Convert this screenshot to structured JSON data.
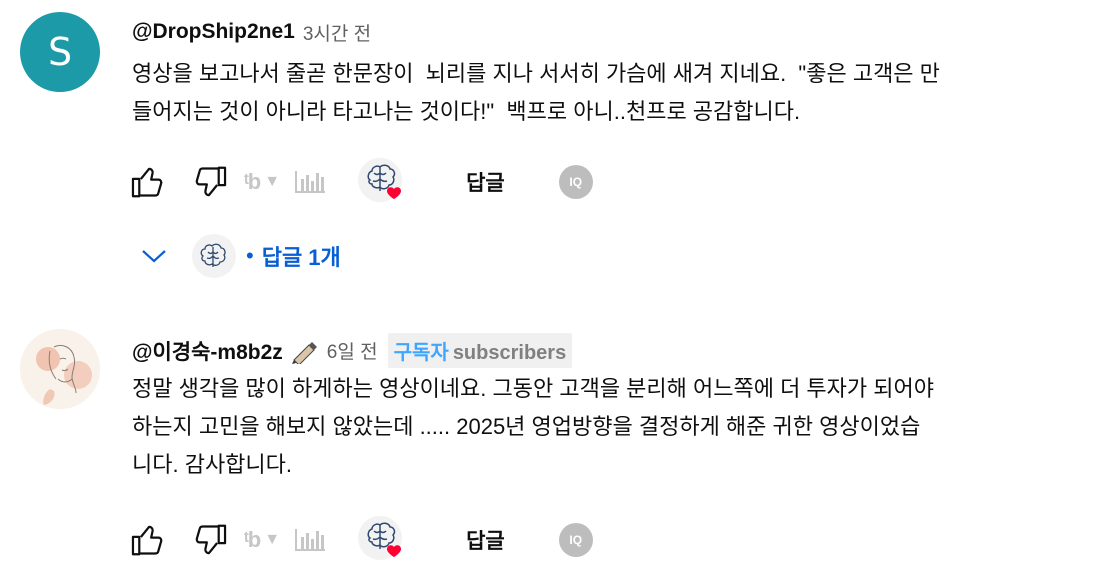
{
  "comments": [
    {
      "avatar_letter": "S",
      "author": "@DropShip2ne1",
      "time": "3시간 전",
      "text": "영상을 보고나서 줄곧 한문장이  뇌리를 지나 서서히 가슴에 새겨 지네요.  \"좋은 고객은 만\n들어지는 것이 아니라 타고나는 것이다!\"  백프로 아니..천프로 공감합니다.",
      "reply_label": "답글",
      "iq_label": "IQ",
      "replies": {
        "label": "답글 1개",
        "dot": "•"
      }
    },
    {
      "author": "@이경숙-m8b2z",
      "time": "6일 전",
      "badge": {
        "subscriber_label": "구독자",
        "suffix": "subscribers"
      },
      "text": "정말 생각을 많이 하게하는 영상이네요. 그동안 고객을 분리해 어느쪽에 더 투자가 되어야\n하는지 고민을 해보지 않았는데 ..... 2025년 영업방향을 결정하게 해준 귀한 영상이었습\n니다. 감사합니다.",
      "reply_label": "답글",
      "iq_label": "IQ"
    }
  ],
  "icons": {
    "like": "thumb-up-icon",
    "dislike": "thumb-down-icon",
    "tubebuddy": "tubebuddy-icon",
    "stats": "bar-chart-icon",
    "brain_heart": "brain-heart-icon",
    "chevron": "chevron-down-icon"
  },
  "colors": {
    "avatar_teal": "#1c9aa8",
    "link_blue": "#065fd4",
    "subscriber_blue": "#3ea6ff",
    "heart_red": "#ff0033"
  }
}
